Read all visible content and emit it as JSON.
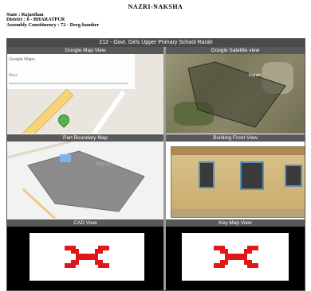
{
  "header": {
    "title": "NAZRI-NAKSHA",
    "state": "State : Rajasthan",
    "district": "District : 6 - BHARATPUR",
    "constituency": "Assembly Constituency : 72 - Deeg-kumher"
  },
  "school": {
    "name": "212 - Govt. Girls Upper Primary School Rarah"
  },
  "panels": {
    "google_map": {
      "label": "Google Map View",
      "overlay_title": "Google Maps",
      "overlay_sub": "Ithas"
    },
    "satellite": {
      "label": "Google Satellite view",
      "place": "Rarah"
    },
    "boundary": {
      "label": "Part Boundary Map",
      "place": "Rarah"
    },
    "building": {
      "label": "Building Front View"
    },
    "cad": {
      "label": "CAD View"
    },
    "key_map": {
      "label": "Key Map View"
    }
  },
  "colors": {
    "header_bar": "#4a4a4a",
    "cell_header": "#595959",
    "symbol": "#e01818",
    "pin": "#55b447"
  }
}
